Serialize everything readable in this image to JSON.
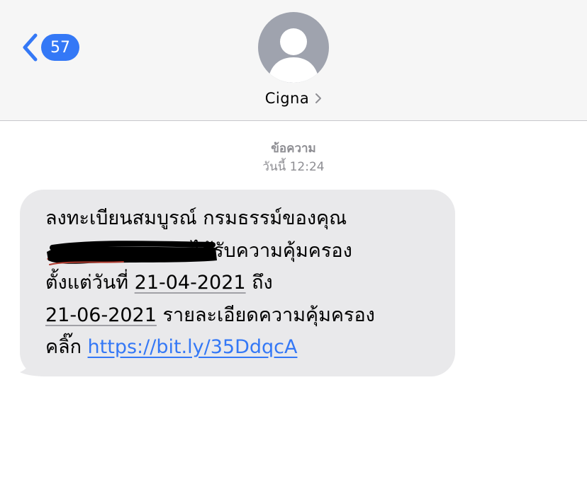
{
  "header": {
    "back_icon": "chevron-left-icon",
    "unread_count": "57",
    "contact_name": "Cigna",
    "contact_chevron_icon": "chevron-right-icon",
    "avatar_icon": "person-silhouette-icon"
  },
  "thread": {
    "timestamp_label": "ข้อความ",
    "timestamp_time": "วันนี้ 12:24"
  },
  "message": {
    "line1": "ลงทะเบียนสมบูรณ์ กรมธรรม์ของคุณ",
    "line2_tail": "ได้รับความคุ้มครอง",
    "line3_prefix": "ตั้งแต่วันที่ ",
    "date_start": "21-04-2021",
    "line3_suffix": " ถึง",
    "date_end": "21-06-2021",
    "line4_suffix": " รายละเอียดความคุ้มครอง",
    "line5_prefix": "คลิ๊ก ",
    "link": "https://bit.ly/35DdqcA",
    "redaction_icon": "redaction-scribble"
  },
  "colors": {
    "accent": "#3478f6",
    "bubble": "#e9e9eb",
    "header_bg": "#f6f6f6",
    "secondary_text": "#8e8e93",
    "avatar_bg": "#9fa3ae"
  }
}
